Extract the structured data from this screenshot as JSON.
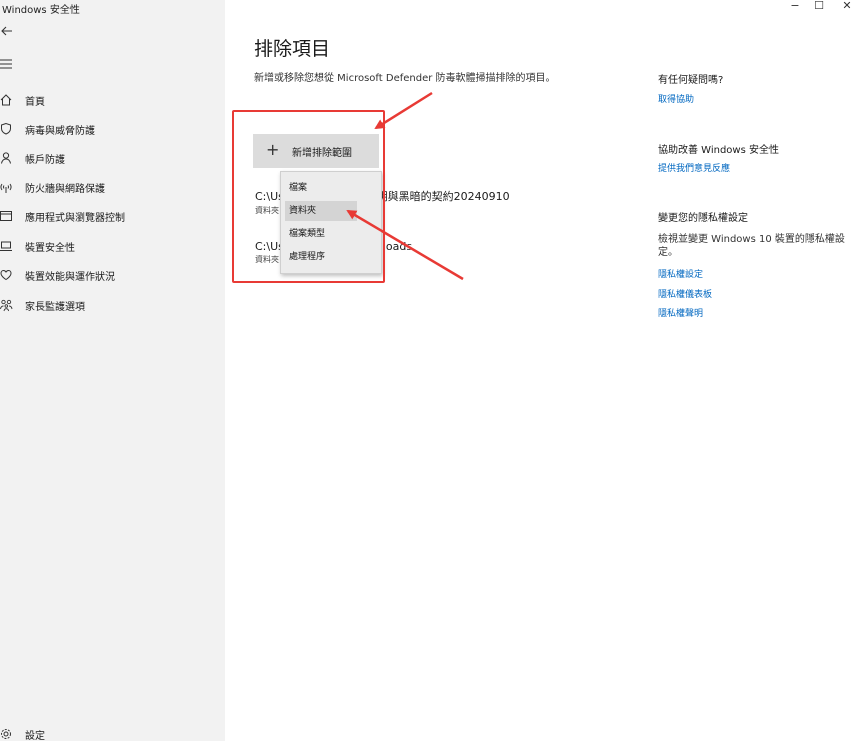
{
  "window": {
    "title": "Windows 安全性",
    "minimize": "−",
    "maximize": "☐",
    "close": "✕"
  },
  "sidebar": {
    "items": [
      {
        "label": "首頁",
        "icon": "home-icon"
      },
      {
        "label": "病毒與威脅防護",
        "icon": "shield-icon"
      },
      {
        "label": "帳戶防護",
        "icon": "person-icon"
      },
      {
        "label": "防火牆與網路保護",
        "icon": "wifi-antenna-icon"
      },
      {
        "label": "應用程式與瀏覽器控制",
        "icon": "app-window-icon"
      },
      {
        "label": "裝置安全性",
        "icon": "laptop-icon"
      },
      {
        "label": "裝置效能與運作狀況",
        "icon": "heart-icon"
      },
      {
        "label": "家長監護選項",
        "icon": "family-icon"
      }
    ],
    "settings_label": "設定",
    "settings_icon": "gear-icon"
  },
  "main": {
    "title": "排除項目",
    "description": "新增或移除您想從 Microsoft Defender 防毒軟體掃描排除的項目。",
    "add_button": {
      "icon": "plus-icon",
      "label": "新增排除範圍"
    },
    "exclusions": [
      {
        "path_left": "C:\\Us",
        "path_right": "top\\光明與黑暗的契約20240910",
        "type": "資料夾"
      },
      {
        "path_left": "C:\\Us",
        "path_right": "nloads",
        "type": "資料夾"
      }
    ],
    "dropdown": {
      "options": [
        "檔案",
        "資料夾",
        "檔案類型",
        "處理程序"
      ],
      "highlighted": "資料夾"
    }
  },
  "right_panel": {
    "help": {
      "heading": "有任何疑問嗎?",
      "link": "取得協助"
    },
    "improve": {
      "heading": "協助改善 Windows 安全性",
      "link": "提供我們意見反應"
    },
    "privacy": {
      "heading": "變更您的隱私權設定",
      "text": "檢視並變更 Windows 10 裝置的隱私權設定。",
      "links": [
        "隱私權設定",
        "隱私權儀表板",
        "隱私權聲明"
      ]
    }
  },
  "colors": {
    "accent_link": "#0067c0",
    "annotation_red": "#e83a35",
    "sidebar_bg": "#f2f2f2"
  }
}
